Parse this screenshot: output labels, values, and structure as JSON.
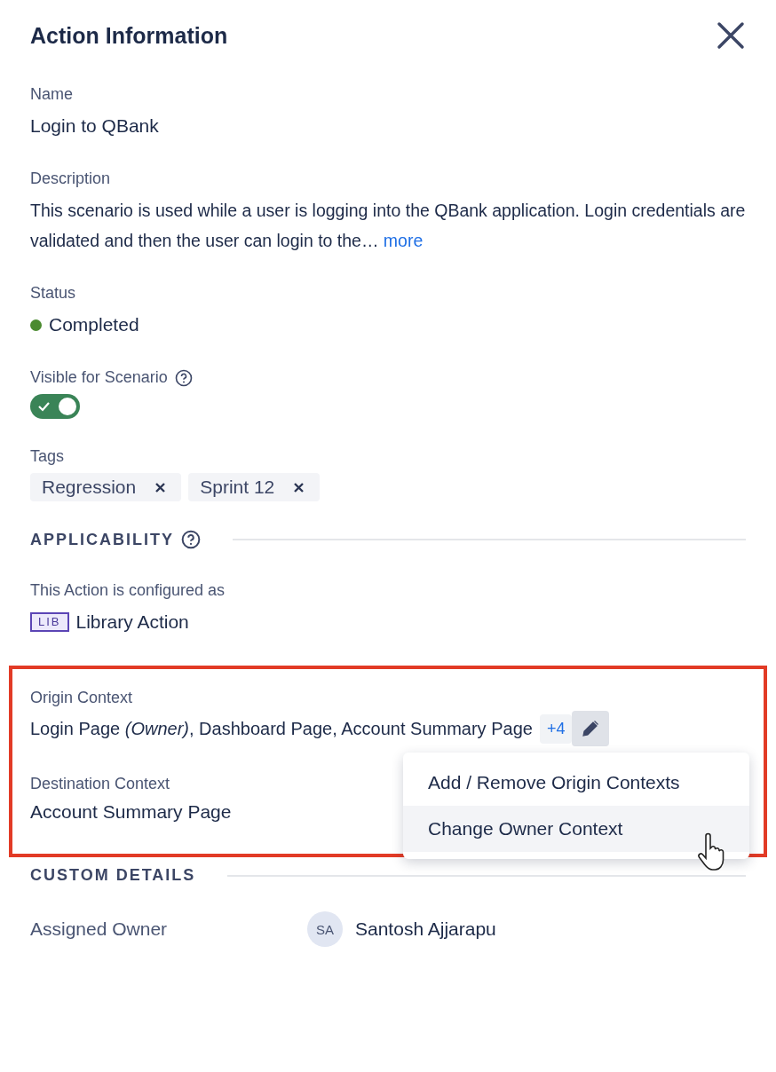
{
  "panel": {
    "title": "Action Information"
  },
  "name": {
    "label": "Name",
    "value": "Login to QBank"
  },
  "description": {
    "label": "Description",
    "value": "This scenario is used while a user is logging into the QBank application. Login credentials are validated and then the user can login to the…",
    "more": "more"
  },
  "status": {
    "label": "Status",
    "value": "Completed",
    "color": "#4a8a2f"
  },
  "visible_for_scenario": {
    "label": "Visible for Scenario",
    "on": true
  },
  "tags": {
    "label": "Tags",
    "items": [
      {
        "label": "Regression"
      },
      {
        "label": "Sprint 12"
      }
    ]
  },
  "applicability": {
    "heading": "APPLICABILITY",
    "configured_label": "This Action is configured as",
    "badge": "LIB",
    "type": "Library Action"
  },
  "origin_context": {
    "label": "Origin Context",
    "value": "Login Page *(Owner)*, Dashboard Page, Account Summary Page",
    "extra": "+4"
  },
  "destination_context": {
    "label": "Destination Context",
    "value": "Account Summary Page"
  },
  "menu": {
    "items": [
      {
        "label": "Add / Remove Origin Contexts",
        "selected": false
      },
      {
        "label": "Change Owner Context",
        "selected": true
      }
    ]
  },
  "custom_details": {
    "heading": "CUSTOM DETAILS",
    "fields": [
      {
        "label": "Assigned Owner",
        "initials": "SA",
        "value": "Santosh Ajjarapu"
      }
    ]
  }
}
